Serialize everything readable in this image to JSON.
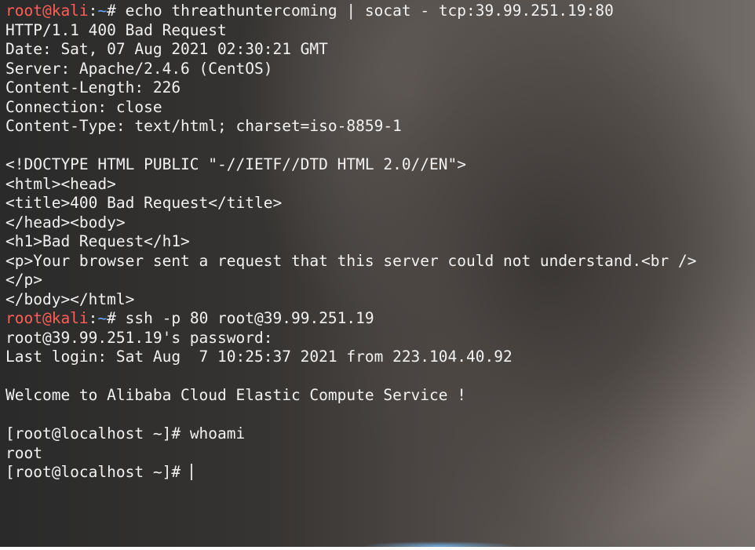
{
  "colors": {
    "prompt_user": "#ff5f57",
    "prompt_path": "#6aa8ff",
    "text": "#f2f2f2"
  },
  "terminal": {
    "kali_prompt": {
      "user_host": "root@kali",
      "separator": ":",
      "path": "~",
      "symbol": "# "
    },
    "commands": [
      "echo threathuntercoming | socat - tcp:39.99.251.19:80",
      "ssh -p 80 root@39.99.251.19"
    ],
    "http_response": [
      "HTTP/1.1 400 Bad Request",
      "Date: Sat, 07 Aug 2021 02:30:21 GMT",
      "Server: Apache/2.4.6 (CentOS)",
      "Content-Length: 226",
      "Connection: close",
      "Content-Type: text/html; charset=iso-8859-1",
      "",
      "<!DOCTYPE HTML PUBLIC \"-//IETF//DTD HTML 2.0//EN\">",
      "<html><head>",
      "<title>400 Bad Request</title>",
      "</head><body>",
      "<h1>Bad Request</h1>",
      "<p>Your browser sent a request that this server could not understand.<br />",
      "</p>",
      "</body></html>"
    ],
    "ssh_output": [
      "root@39.99.251.19's password:",
      "Last login: Sat Aug  7 10:25:37 2021 from 223.104.40.92",
      "",
      "Welcome to Alibaba Cloud Elastic Compute Service !",
      ""
    ],
    "remote_prompt": "[root@localhost ~]# ",
    "remote_command": "whoami",
    "remote_output": "root"
  }
}
